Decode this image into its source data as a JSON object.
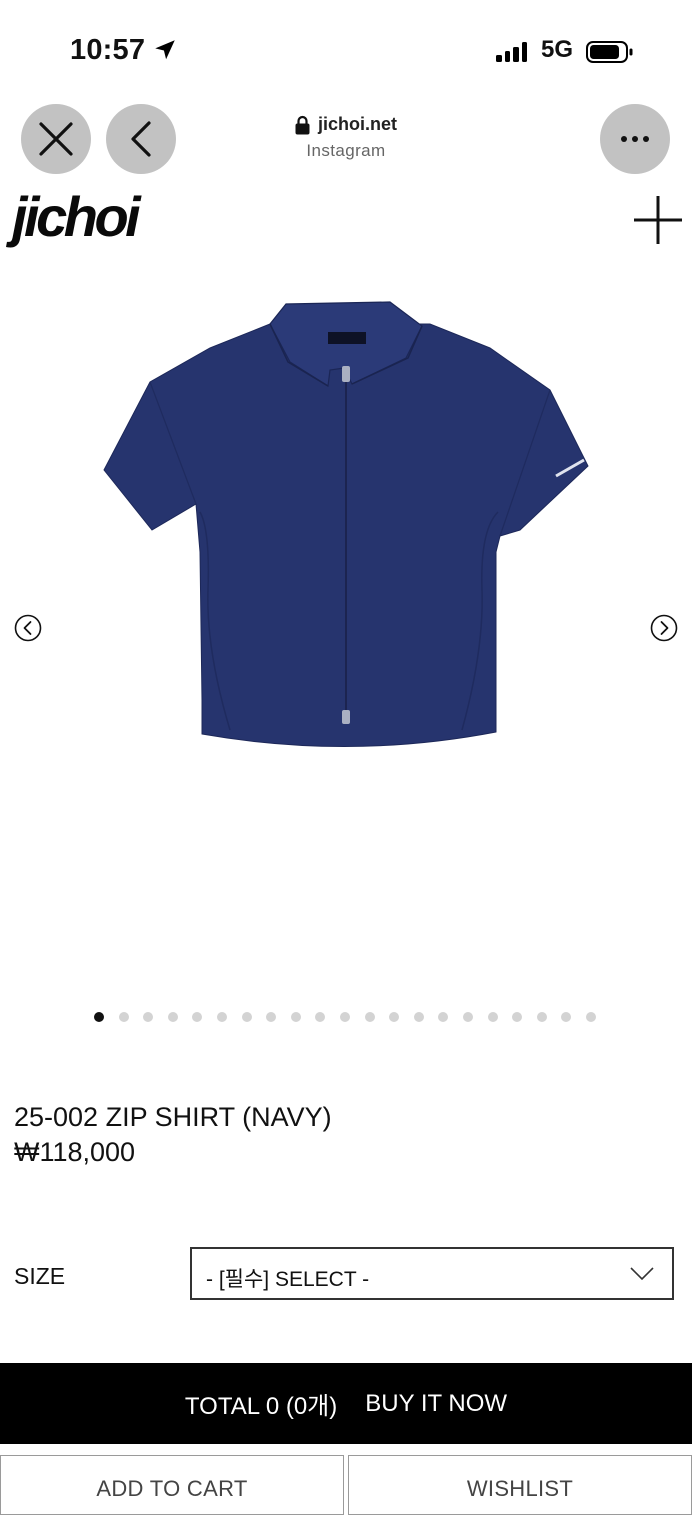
{
  "status_bar": {
    "time": "10:57",
    "network": "5G"
  },
  "browser": {
    "domain": "jichoi.net",
    "subtitle": "Instagram"
  },
  "site": {
    "logo": "jichoi"
  },
  "gallery": {
    "total_images": 21,
    "active_index": 0
  },
  "product": {
    "name": "25-002 ZIP SHIRT (NAVY)",
    "price": "₩118,000",
    "size_label": "SIZE",
    "size_select": "- [필수] SELECT -"
  },
  "actions": {
    "total": "TOTAL 0 (0개)",
    "buy_now": "BUY IT NOW",
    "add_to_cart": "ADD TO CART",
    "wishlist": "WISHLIST"
  },
  "colors": {
    "shirt": "#26346e",
    "accent": "#000000",
    "button_grey": "#c2c2c2"
  },
  "icons": [
    "location-arrow-icon",
    "signal-icon",
    "battery-icon",
    "close-icon",
    "chevron-left-icon",
    "lock-icon",
    "more-icon",
    "plus-icon",
    "chevron-circle-left-icon",
    "chevron-circle-right-icon",
    "chevron-down-icon"
  ]
}
